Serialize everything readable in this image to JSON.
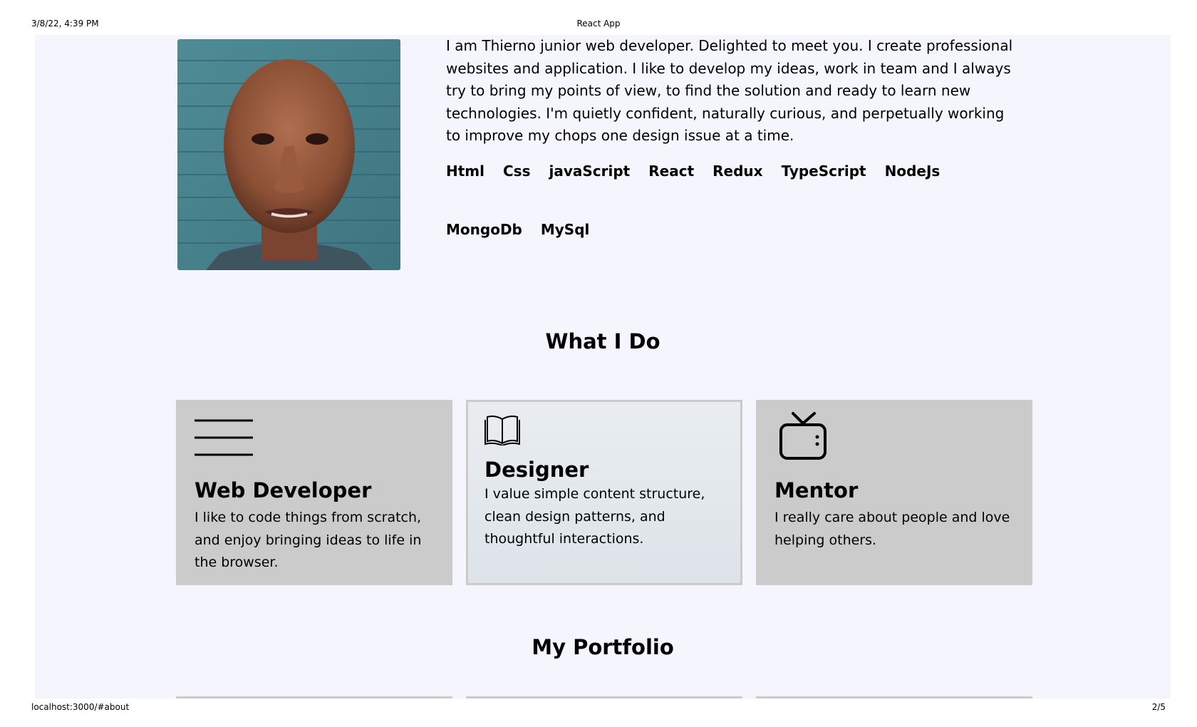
{
  "print_header": {
    "date": "3/8/22, 4:39 PM",
    "title": "React App"
  },
  "print_footer": {
    "url": "localhost:3000/#about",
    "page": "2/5"
  },
  "about": {
    "text": "I am Thierno junior web developer. Delighted to meet you. I create professional websites and application. I like to develop my ideas, work in team and I always try to bring my points of view, to find the solution and ready to learn new technologies. I'm quietly confident, naturally curious, and perpetually working to improve my chops one design issue at a time.",
    "skills": [
      "Html",
      "Css",
      "javaScript",
      "React",
      "Redux",
      "TypeScript",
      "NodeJs",
      "MongoDb",
      "MySql"
    ]
  },
  "what_i_do": {
    "title": "What I Do",
    "cards": [
      {
        "icon": "menu-lines-icon",
        "title": "Web Developer",
        "text": "I like to code things from scratch, and enjoy bringing ideas to life in the browser."
      },
      {
        "icon": "book-icon",
        "title": "Designer",
        "text": "I value simple content structure, clean design patterns, and thoughtful interactions."
      },
      {
        "icon": "tv-icon",
        "title": "Mentor",
        "text": "I really care about people and love helping others."
      }
    ]
  },
  "portfolio": {
    "title": "My Portfolio"
  },
  "colors": {
    "page_bg": "#f5f6fd",
    "card_bg": "#cbcbcb",
    "card_hover_bg": "#e3e8ec"
  }
}
